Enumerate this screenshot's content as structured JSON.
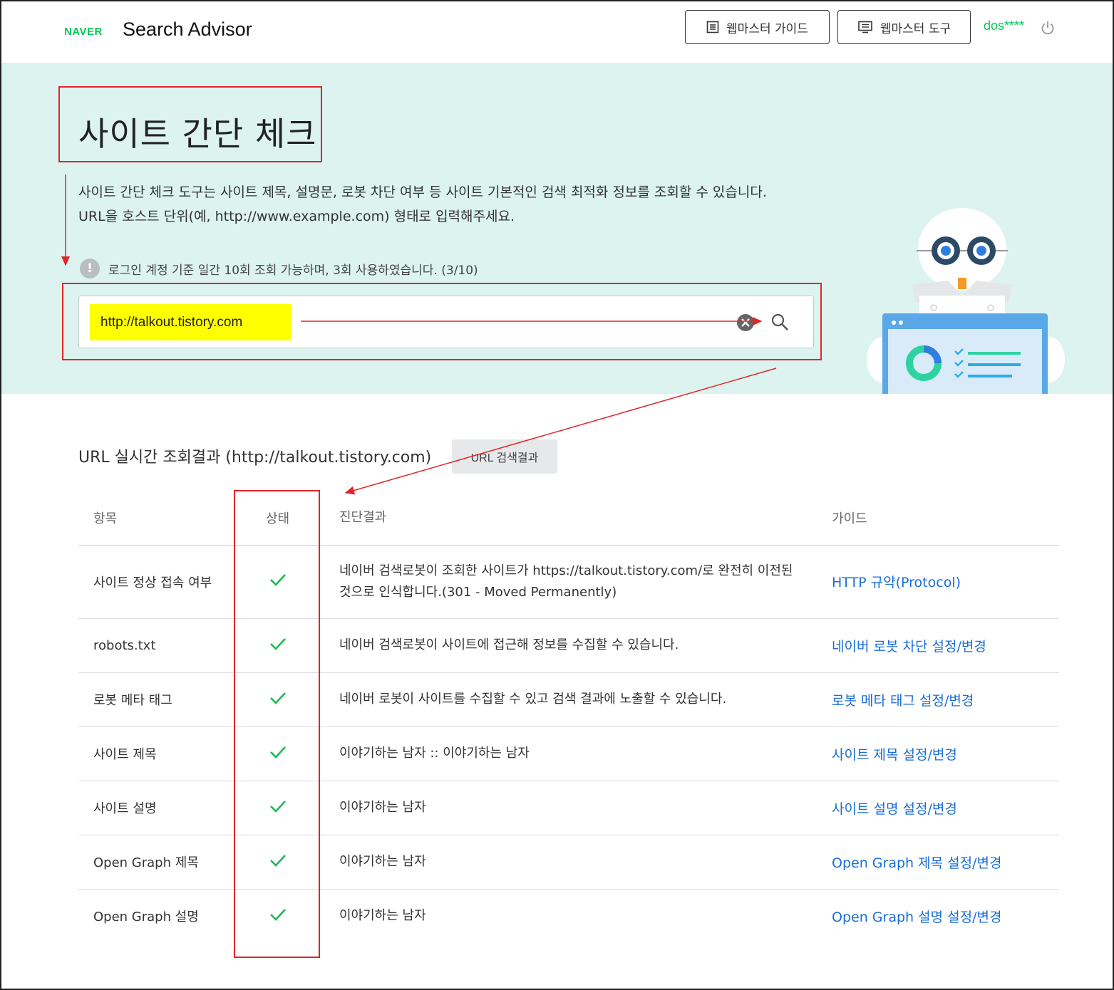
{
  "header": {
    "brand": "NAVER",
    "app_name": "Search Advisor",
    "guide_button": "웹마스터 가이드",
    "tool_button": "웹마스터 도구",
    "user": "dos****"
  },
  "hero": {
    "title": "사이트 간단 체크",
    "description_line1": "사이트 간단 체크 도구는 사이트 제목, 설명문, 로봇 차단 여부 등 사이트 기본적인 검색 최적화 정보를 조회할 수 있습니다.",
    "description_line2": "URL을 호스트 단위(예, http://www.example.com) 형태로 입력해주세요.",
    "limit_notice": "로그인 계정 기준 일간 10회 조회 가능하며, 3회 사용하였습니다. (3/10)",
    "search_value": "http://talkout.tistory.com"
  },
  "result": {
    "title": "URL 실시간 조회결과 (http://talkout.tistory.com)",
    "search_result_button": "URL 검색결과",
    "columns": [
      "항목",
      "상태",
      "진단결과",
      "가이드"
    ],
    "rows": [
      {
        "item": "사이트 정상 접속 여부",
        "status": "ok",
        "diagnosis": "네이버 검색로봇이 조회한 사이트가 https://talkout.tistory.com/로 완전히 이전된 것으로 인식합니다.(301 - Moved Permanently)",
        "guide": "HTTP 규약(Protocol)"
      },
      {
        "item": "robots.txt",
        "status": "ok",
        "diagnosis": "네이버 검색로봇이 사이트에 접근해 정보를 수집할 수 있습니다.",
        "guide": "네이버 로봇 차단 설정/변경"
      },
      {
        "item": "로봇 메타 태그",
        "status": "ok",
        "diagnosis": "네이버 로봇이 사이트를 수집할 수 있고 검색 결과에 노출할 수 있습니다.",
        "guide": "로봇 메타 태그 설정/변경"
      },
      {
        "item": "사이트 제목",
        "status": "ok",
        "diagnosis": "이야기하는 남자 :: 이야기하는 남자",
        "guide": "사이트 제목 설정/변경"
      },
      {
        "item": "사이트 설명",
        "status": "ok",
        "diagnosis": "이야기하는 남자",
        "guide": "사이트 설명 설정/변경"
      },
      {
        "item": "Open Graph 제목",
        "status": "ok",
        "diagnosis": "이야기하는 남자",
        "guide": "Open Graph 제목 설정/변경"
      },
      {
        "item": "Open Graph 설명",
        "status": "ok",
        "diagnosis": "이야기하는 남자",
        "guide": "Open Graph 설명 설정/변경"
      }
    ]
  },
  "colors": {
    "brand_green": "#03c75a",
    "hero_bg": "#dcf3f0",
    "annotation_red": "#e0262b",
    "highlight_yellow": "#ffff00",
    "link_blue": "#1a6ed6",
    "check_green": "#1db954"
  },
  "icons": [
    "guide-list-icon",
    "monitor-icon",
    "power-icon",
    "info-icon",
    "clear-icon",
    "search-icon",
    "check-icon"
  ]
}
